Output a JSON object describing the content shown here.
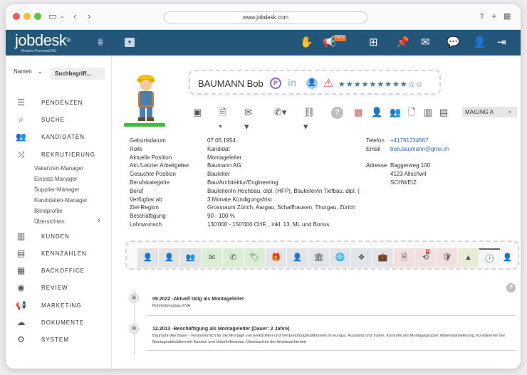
{
  "browser": {
    "url": "www.jobdesk.com"
  },
  "topbar": {
    "logo": "jobdesk",
    "logo_registered": "®",
    "logo_sub": "Muster Personal AG",
    "new_badge": "NEU"
  },
  "sidebar": {
    "filter_label": "Namen",
    "search_placeholder": "Suchbegriff...",
    "nav": [
      {
        "label": "PENDENZEN",
        "icon": "checklist-icon"
      },
      {
        "label": "SUCHE",
        "icon": "search-icon"
      },
      {
        "label": "KANDIDATEN",
        "icon": "people-icon"
      },
      {
        "label": "REKRUTIERUNG",
        "icon": "shuffle-icon"
      }
    ],
    "sub_items": [
      "Vakanzen-Manager",
      "Einsatz-Manager",
      "Supplier-Manager",
      "Kandidaten-Manager",
      "Blindprofile",
      "Übersichten"
    ],
    "nav2": [
      {
        "label": "KUNDEN",
        "icon": "building-icon"
      },
      {
        "label": "KENNZAHLEN",
        "icon": "chart-icon"
      },
      {
        "label": "BACKOFFICE",
        "icon": "calculator-icon"
      },
      {
        "label": "REVIEW",
        "icon": "eye-icon"
      },
      {
        "label": "MARKETING",
        "icon": "megaphone-icon"
      },
      {
        "label": "DOKUMENTE",
        "icon": "cloud-icon"
      },
      {
        "label": "SYSTEM",
        "icon": "settings-icon"
      }
    ]
  },
  "profile": {
    "name": "BAUMANN Bob",
    "rating_full": 9,
    "rating_total": 11,
    "mailing": "MAILING A"
  },
  "details": {
    "labels": [
      "Geburtsdatum",
      "Rolle",
      "Aktuelle Position",
      "Akt./Letzter Arbeitgeber",
      "Gesuchte Position",
      "Berufskategorie",
      "Beruf",
      "Verfügbar ab",
      "Ziel-Region",
      "Beschäftigung",
      "Lohnwunsch"
    ],
    "values": [
      "07.06.1954",
      "Kandidat",
      "Montageleiter",
      "Baumann AG",
      "Bauleiter",
      "Bau/Architektur/Engineering",
      "Bauleiter/in Hochbau, dipl. (HFP), Bauleiter/in Tiefbau, dipl. (",
      "3 Monate Kündigungsfrist",
      "Grossraum Zürich, Aargau, Schaffhausen, Thurgau, Zürich",
      "90 - 100 %",
      "130'000 - 150'000 CHF, , inkl. 13. ML und Bonus"
    ]
  },
  "contact": {
    "telefon_label": "Telefon",
    "telefon": "+41791234567",
    "email_label": "Email",
    "email": "bob.baumann@gmx.ch",
    "adresse_label": "Adresse",
    "street": "Baggerweg 100",
    "city": "4123 Allschwil",
    "country": "SCHWEIZ"
  },
  "tab_badge": "8",
  "timeline": [
    {
      "title": "09.2022 -Aktuell tätig als Montageleiter",
      "text": "Rohrleitungsbau KVA"
    },
    {
      "title": "12.2013 -Beschäftigung als Montageleiter (Dauer: 2 Jahre)",
      "text": "Baumann AG Basel - Verantwortlich für die Montage von Elektrofilter und Verdampfungskühltürmen in Europa, Russland und Türkei. Kontrolle der Montagegruppe, Materialanlieferung, koordinieren der Montageaktivitäten mit Kunden und Unterlieferanten. Überwachen der Arbeitssicherheit"
    }
  ],
  "colors": {
    "topbar": "#24567a",
    "accent_green": "#3dbb3d",
    "link": "#2b6cb0",
    "star": "#3b74b6"
  }
}
